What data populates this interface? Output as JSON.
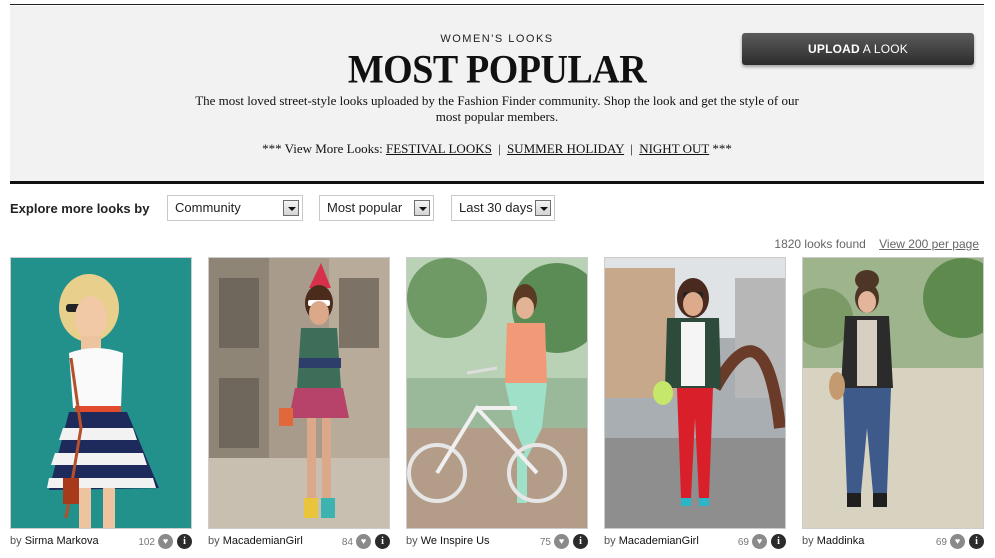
{
  "hero": {
    "kicker": "WOMEN'S LOOKS",
    "title": "MOST POPULAR",
    "description": "The most loved street-style looks uploaded by the Fashion Finder community. Shop the look and get the style of our most popular members.",
    "more_prefix": "*** View More Looks:",
    "more_suffix": "***",
    "more_links": [
      "FESTIVAL LOOKS",
      "SUMMER HOLIDAY",
      "NIGHT OUT"
    ],
    "separator": "|"
  },
  "upload_button": {
    "bold": "UPLOAD",
    "rest": " A LOOK"
  },
  "filters": {
    "label": "Explore more looks by",
    "selects": [
      "Community",
      "Most popular",
      "Last 30 days"
    ]
  },
  "results": {
    "count_text": "1820 looks found",
    "per_page_link": "View 200 per page"
  },
  "cards": [
    {
      "by": "by",
      "author": "Sirma Markova",
      "likes": "102",
      "info": "i"
    },
    {
      "by": "by",
      "author": "MacademianGirl",
      "likes": "84",
      "info": "i"
    },
    {
      "by": "by",
      "author": "We Inspire Us",
      "likes": "75",
      "info": "i"
    },
    {
      "by": "by",
      "author": "MacademianGirl",
      "likes": "69",
      "info": "i"
    },
    {
      "by": "by",
      "author": "Maddinka",
      "likes": "69",
      "info": "i"
    }
  ],
  "colors": {
    "hero_bg": "#f2f2f2",
    "button_dark": "#2c2c2c",
    "heart_grey": "#8a8a8a"
  },
  "icons": {
    "heart": "heart-icon",
    "info": "info-icon",
    "dropdown": "chevron-down-icon"
  }
}
